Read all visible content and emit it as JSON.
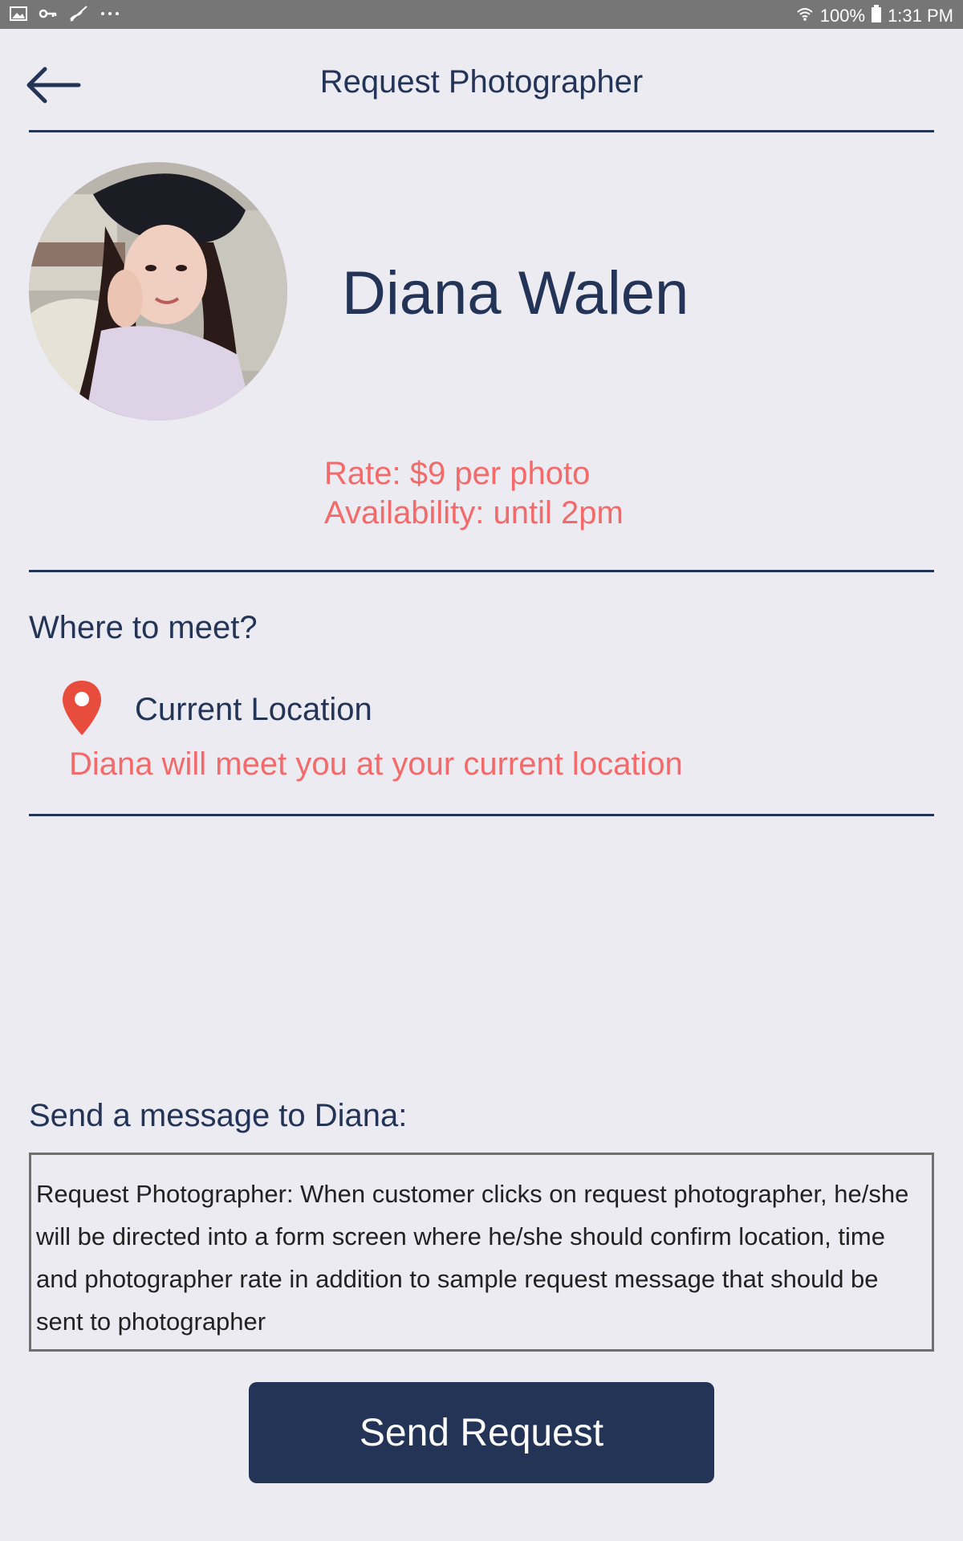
{
  "status_bar": {
    "battery": "100%",
    "time": "1:31 PM",
    "icons": [
      "image-icon",
      "key-icon",
      "signature-icon",
      "more-dots-icon",
      "wifi-icon",
      "battery-icon"
    ]
  },
  "header": {
    "title": "Request Photographer",
    "back_icon": "arrow-left-icon"
  },
  "profile": {
    "name": "Diana Walen",
    "rate": "Rate: $9 per photo",
    "availability": "Availability: until 2pm"
  },
  "meeting": {
    "heading": "Where to meet?",
    "location_label": "Current Location",
    "location_icon": "map-pin-icon",
    "description": "Diana will meet you at your current location"
  },
  "message": {
    "heading": "Send a message to Diana:",
    "body": "Request Photographer: When customer clicks on request photographer, he/she will be directed into a form screen where he/she should confirm location, time and photographer rate in addition to sample request message that should be sent to photographer"
  },
  "actions": {
    "send_label": "Send Request"
  },
  "colors": {
    "primary": "#233457",
    "accent": "#f26a6a",
    "background": "#ebebf1",
    "status_bar": "#767676",
    "pin": "#e84c3d"
  }
}
